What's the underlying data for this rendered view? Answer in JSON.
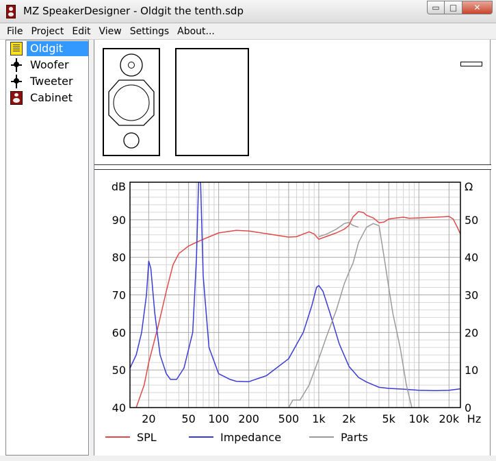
{
  "window": {
    "title": "MZ SpeakerDesigner - Oldgit the tenth.sdp",
    "minimize": "▭",
    "maximize": "□",
    "close": "✕"
  },
  "menu": [
    "File",
    "Project",
    "Edit",
    "View",
    "Settings",
    "About..."
  ],
  "tree": {
    "items": [
      {
        "label": "Oldgit",
        "icon": "project-icon",
        "selected": true
      },
      {
        "label": "Woofer",
        "icon": "driver-icon",
        "selected": false
      },
      {
        "label": "Tweeter",
        "icon": "driver-icon",
        "selected": false
      },
      {
        "label": "Cabinet",
        "icon": "cabinet-icon",
        "selected": false
      }
    ]
  },
  "colors": {
    "spl": "#e04848",
    "impedance": "#3a3ad8",
    "parts": "#9a9a9a",
    "selection": "#3399ff"
  },
  "chart_data": {
    "type": "line",
    "xscale": "log",
    "xlim": [
      13,
      26000
    ],
    "x_ticks": [
      {
        "value": 20,
        "label": "20"
      },
      {
        "value": 50,
        "label": "50"
      },
      {
        "value": 100,
        "label": "100"
      },
      {
        "value": 200,
        "label": "200"
      },
      {
        "value": 500,
        "label": "500"
      },
      {
        "value": 1000,
        "label": "1k"
      },
      {
        "value": 2000,
        "label": "2k"
      },
      {
        "value": 5000,
        "label": "5k"
      },
      {
        "value": 10000,
        "label": "10k"
      },
      {
        "value": 20000,
        "label": "20k"
      }
    ],
    "x_unit": "Hz",
    "left_axis": {
      "unit": "dB",
      "lim": [
        40,
        100
      ],
      "ticks": [
        40,
        50,
        60,
        70,
        80,
        90
      ]
    },
    "right_axis": {
      "unit": "Ω",
      "lim": [
        0,
        60
      ],
      "ticks": [
        0,
        10,
        20,
        30,
        40,
        50
      ]
    },
    "grid": true,
    "legend": "bottom",
    "series": [
      {
        "name": "SPL",
        "axis": "left",
        "points": [
          [
            13,
            35
          ],
          [
            15,
            40
          ],
          [
            18,
            46
          ],
          [
            20,
            52
          ],
          [
            25,
            62
          ],
          [
            30,
            71
          ],
          [
            35,
            78
          ],
          [
            40,
            81
          ],
          [
            50,
            83
          ],
          [
            60,
            84
          ],
          [
            70,
            84.8
          ],
          [
            100,
            86.5
          ],
          [
            150,
            87.2
          ],
          [
            200,
            87
          ],
          [
            300,
            86.3
          ],
          [
            500,
            85.4
          ],
          [
            600,
            85.5
          ],
          [
            700,
            86.2
          ],
          [
            800,
            86.8
          ],
          [
            900,
            86.2
          ],
          [
            1000,
            84.8
          ],
          [
            1200,
            85.6
          ],
          [
            1500,
            86.5
          ],
          [
            1800,
            87.5
          ],
          [
            2000,
            88.5
          ],
          [
            2200,
            90.8
          ],
          [
            2500,
            92.2
          ],
          [
            2800,
            91.9
          ],
          [
            3000,
            91.2
          ],
          [
            3500,
            90.5
          ],
          [
            4000,
            89.2
          ],
          [
            4500,
            89.4
          ],
          [
            5000,
            90.2
          ],
          [
            6000,
            90.5
          ],
          [
            7000,
            90.7
          ],
          [
            8000,
            90.4
          ],
          [
            10000,
            90.5
          ],
          [
            12000,
            90.6
          ],
          [
            15000,
            90.7
          ],
          [
            18000,
            90.8
          ],
          [
            20000,
            90.9
          ],
          [
            22000,
            90.2
          ],
          [
            24000,
            88.2
          ],
          [
            26000,
            86.2
          ]
        ]
      },
      {
        "name": "Impedance",
        "axis": "right",
        "points": [
          [
            13,
            10.5
          ],
          [
            15,
            14
          ],
          [
            17,
            20
          ],
          [
            19,
            30
          ],
          [
            20,
            39
          ],
          [
            21,
            37
          ],
          [
            23,
            25
          ],
          [
            26,
            14
          ],
          [
            30,
            9
          ],
          [
            33,
            7.5
          ],
          [
            38,
            7.5
          ],
          [
            45,
            10.5
          ],
          [
            55,
            20
          ],
          [
            60,
            40
          ],
          [
            63,
            60
          ],
          [
            66,
            60
          ],
          [
            70,
            35
          ],
          [
            80,
            16
          ],
          [
            100,
            9
          ],
          [
            130,
            7.5
          ],
          [
            150,
            7
          ],
          [
            200,
            6.9
          ],
          [
            300,
            8.5
          ],
          [
            500,
            13
          ],
          [
            700,
            20
          ],
          [
            850,
            27
          ],
          [
            950,
            32
          ],
          [
            1000,
            32.5
          ],
          [
            1100,
            31
          ],
          [
            1300,
            25
          ],
          [
            1600,
            17
          ],
          [
            2000,
            11
          ],
          [
            2500,
            8
          ],
          [
            3000,
            6.8
          ],
          [
            4000,
            5.4
          ],
          [
            5000,
            5.1
          ],
          [
            7000,
            4.9
          ],
          [
            10000,
            4.6
          ],
          [
            15000,
            4.5
          ],
          [
            20000,
            4.6
          ],
          [
            26000,
            5.0
          ]
        ]
      },
      {
        "name": "Parts",
        "axis": "left",
        "points": [
          [
            500,
            40
          ],
          [
            550,
            42
          ],
          [
            650,
            42
          ],
          [
            800,
            46
          ],
          [
            1000,
            53
          ],
          [
            1200,
            59
          ],
          [
            1500,
            66
          ],
          [
            1800,
            73
          ],
          [
            2000,
            76
          ],
          [
            2200,
            78.5
          ],
          [
            2500,
            84
          ],
          [
            3000,
            88
          ],
          [
            3500,
            89
          ],
          [
            4000,
            88.4
          ],
          [
            4500,
            80
          ],
          [
            5000,
            72
          ],
          [
            5500,
            65
          ],
          [
            6500,
            56
          ],
          [
            7500,
            46
          ],
          [
            8500,
            40
          ]
        ]
      },
      {
        "name": "",
        "axis": "left",
        "points": [
          [
            1000,
            85.5
          ],
          [
            1200,
            86.2
          ],
          [
            1500,
            87.5
          ],
          [
            1800,
            89
          ],
          [
            2000,
            89.3
          ],
          [
            2200,
            88.5
          ],
          [
            2500,
            88
          ]
        ]
      }
    ]
  }
}
